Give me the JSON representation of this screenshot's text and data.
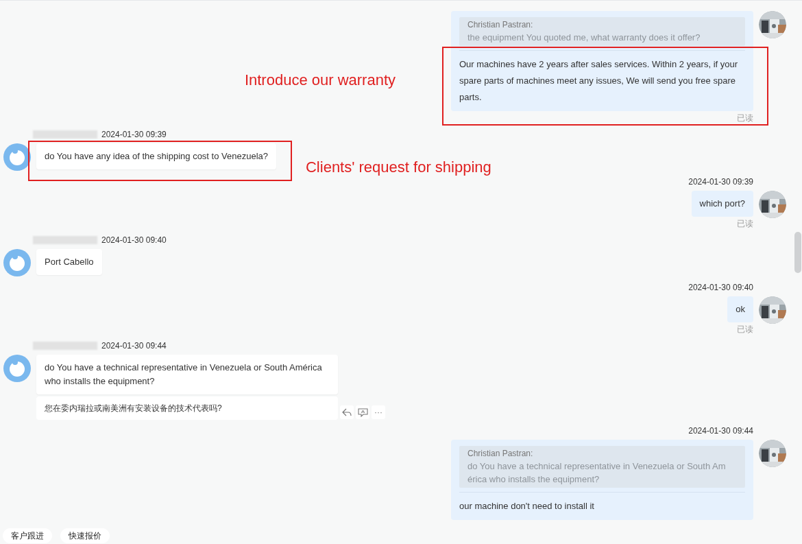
{
  "messages": [
    {
      "kind": "outgoing",
      "quote": {
        "author": "Christian Pastran:",
        "text": "the equipment You quoted me, what warranty does it offer?"
      },
      "text": "Our machines have 2 years after sales services. Within 2 years, if your spare parts of machines meet any issues, We will send you free spare parts.",
      "read": "已读",
      "annotation": "Introduce our warranty"
    },
    {
      "kind": "incoming",
      "time": "2024-01-30 09:39",
      "text": "do You have any idea of the shipping cost to Venezuela?",
      "annotation": "Clients' request for shipping"
    },
    {
      "kind": "outgoing",
      "time": "2024-01-30 09:39",
      "text": "which port?",
      "read": "已读"
    },
    {
      "kind": "incoming",
      "time": "2024-01-30 09:40",
      "text": "Port Cabello"
    },
    {
      "kind": "outgoing",
      "time": "2024-01-30 09:40",
      "text": "ok",
      "read": "已读"
    },
    {
      "kind": "incoming",
      "time": "2024-01-30 09:44",
      "text": "do You have a technical representative in Venezuela or South América who installs the equipment?",
      "translation": "您在委内瑞拉或南美洲有安装设备的技术代表吗?",
      "more_label": "···"
    },
    {
      "kind": "outgoing",
      "time": "2024-01-30 09:44",
      "quote": {
        "author": "Christian Pastran:",
        "text": "do You have a technical representative in Venezuela or South Am érica who installs the equipment?"
      },
      "text": "our machine don't need to install it"
    }
  ],
  "bottom_tabs": [
    "客户跟进",
    "快速报价"
  ]
}
